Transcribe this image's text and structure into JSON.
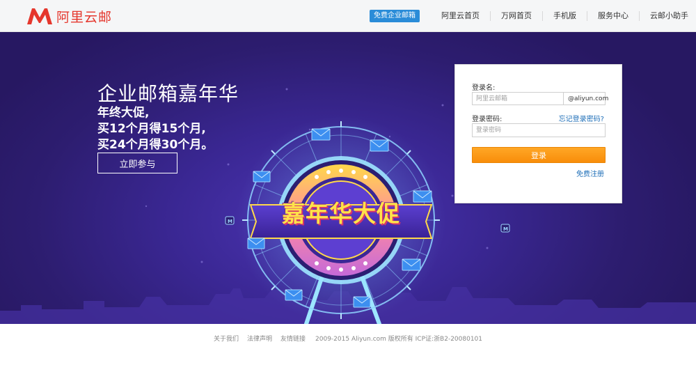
{
  "header": {
    "logo_text": "阿里云邮",
    "promo_label": "免费企业邮箱",
    "nav": [
      "阿里云首页",
      "万网首页",
      "手机版",
      "服务中心",
      "云邮小助手"
    ]
  },
  "hero": {
    "title": "企业邮箱嘉年华",
    "line1": "年终大促,",
    "line2": "买12个月得15个月,",
    "line3": "买24个月得30个月。",
    "cta_label": "立即参与",
    "wheel_text": "嘉年华大促"
  },
  "login": {
    "username_label": "登录名:",
    "username_placeholder": "阿里云邮箱",
    "domain": "@aliyun.com",
    "password_label": "登录密码:",
    "forgot_label": "忘记登录密码?",
    "password_placeholder": "登录密码",
    "submit_label": "登录",
    "register_label": "免费注册"
  },
  "footer": {
    "links": [
      "关于我们",
      "法律声明",
      "友情链接"
    ],
    "copyright": "2009-2015 Aliyun.com 版权所有 ICP证:浙B2-20080101"
  },
  "colors": {
    "brand_red": "#e5372d",
    "promo_blue": "#2a8cd8",
    "hero_purple": "#3a2793",
    "login_orange": "#f99a14",
    "link_blue": "#1f6fb8"
  }
}
